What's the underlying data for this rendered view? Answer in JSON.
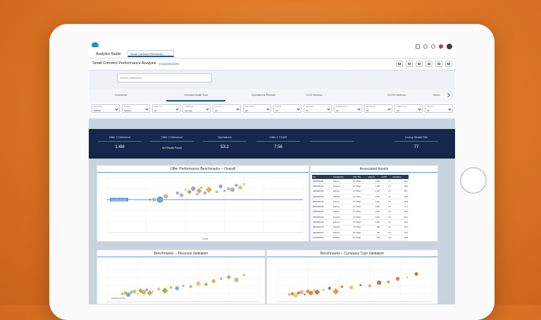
{
  "app": {
    "name": "Analytics Studio",
    "tab_label": "Small Connect Performan..."
  },
  "dashboard": {
    "title": "Small Connect Performance Analysis",
    "subtitle": "▾ DASHBOARD"
  },
  "search": {
    "placeholder": "Search dashboards"
  },
  "tabs": [
    {
      "label": "Overview"
    },
    {
      "label": "Connect Audit Tool"
    },
    {
      "label": "Operations Review"
    },
    {
      "label": "CCD Review"
    },
    {
      "label": "CCRD Metrics"
    },
    {
      "label": "More"
    }
  ],
  "filters": [
    {
      "label": "Cl Number",
      "value": "PHASE"
    },
    {
      "label": "Product",
      "value": "Subject"
    },
    {
      "label": "Segment",
      "value": "All"
    },
    {
      "label": "Cl Manager",
      "value": "Average"
    },
    {
      "label": "Location",
      "value": "All"
    },
    {
      "label": "Site Number",
      "value": "All"
    },
    {
      "label": "Unit ID",
      "value": "All"
    },
    {
      "label": "Call Label",
      "value": "All"
    },
    {
      "label": "Al Wage Form",
      "value": "All"
    },
    {
      "label": "Level Code",
      "value": "All"
    },
    {
      "label": "CCRD Code",
      "value": "All"
    },
    {
      "label": "Country",
      "value": "All"
    }
  ],
  "kpis": [
    {
      "label": "Offer 1 Delivered",
      "value": "1.4M"
    },
    {
      "label": "Offer 2 Delivered",
      "value": "No Results Found"
    },
    {
      "label": "Operations",
      "value": "53.2"
    },
    {
      "label": "Offer 1 CCDR",
      "value": "7.56"
    },
    {
      "label": "",
      "value": ""
    },
    {
      "label": "Lineup Model Site",
      "value": "77"
    }
  ],
  "overall_chart": {
    "title": "Offer Performance Benchmarks -- Overall",
    "xlabel": "Close",
    "reference_label": "Avg Benchmark",
    "reference_y": 60
  },
  "assoc": {
    "title": "Associated Assets",
    "columns": [
      "Ref",
      "Classification",
      "Offer Title",
      "Delivery",
      "CCRR",
      "Operations"
    ],
    "rows": [
      [
        "ID000081261",
        "Delivery",
        "CT Offset",
        "1.23K",
        "2.7",
        "60.2"
      ],
      [
        "ID000081262",
        "Advance",
        "CT Offset",
        "1.16K",
        "2.4",
        "58.5"
      ],
      [
        "ID000081263",
        "Delivery",
        "CT Offset",
        "1.13K",
        "2.1",
        "55.7"
      ],
      [
        "ID000081264",
        "Advance",
        "CT Offset",
        "1.11K",
        "1.4",
        "54.8"
      ],
      [
        "ID000081265",
        "Delivery",
        "CT Offset",
        "1.02K",
        "2.4",
        "53.9"
      ],
      [
        "ID000081266",
        "Delivery",
        "CT Offset",
        "1.02K",
        "2.3",
        "57.1"
      ],
      [
        "ID000081267",
        "Delivery",
        "CT Offset",
        "1.01K",
        "3.1",
        "52.6"
      ],
      [
        "ID000081268",
        "Advance",
        "CT Offset",
        "1.01K",
        "1.8",
        "52.1"
      ],
      [
        "ID000081269",
        "Delivery",
        "CT Offset",
        "1.00K",
        "2.1",
        "51.9"
      ],
      [
        "ID000081270",
        "Advance",
        "CT Offset",
        "967",
        "2.4",
        "51.5"
      ],
      [
        "ID000081271",
        "Delivery",
        "CT Offset",
        "931",
        "2.6",
        "51.2"
      ],
      [
        "ID000081272",
        "Advance",
        "CT Offset",
        "926",
        "1.9",
        "50.8"
      ],
      [
        "ID000081273",
        "Delivery",
        "CT Offset",
        "909",
        "2.4",
        "50.5"
      ],
      [
        "ID000081274",
        "Advance",
        "CT Offset",
        "874",
        "2.3",
        "50.1"
      ],
      [
        "ID000081275",
        "Delivery",
        "CT Offset",
        "853",
        "2.2",
        "49.9"
      ]
    ]
  },
  "personal_chart": {
    "title": "Benchmarks -- Personal Validation",
    "annotation": "Avg Benchmark"
  },
  "company_chart": {
    "title": "Benchmarks -- Company Type Validation"
  },
  "chart_data": [
    {
      "type": "scatter",
      "title": "Offer Performance Benchmarks -- Overall",
      "xlabel": "Close",
      "ylabel": "",
      "xlim": [
        0,
        100
      ],
      "ylim": [
        0,
        100
      ],
      "grid": true,
      "x": [
        22,
        24,
        30,
        36,
        38,
        40,
        42,
        44,
        46,
        47,
        48,
        50,
        52,
        56,
        58,
        60,
        62,
        64,
        66,
        68,
        70
      ],
      "y": [
        60,
        60,
        66,
        72,
        68,
        78,
        74,
        80,
        70,
        76,
        82,
        72,
        78,
        74,
        84,
        76,
        80,
        78,
        86,
        82,
        88
      ]
    },
    {
      "type": "scatter",
      "title": "Benchmarks -- Personal Validation",
      "xlim": [
        0,
        100
      ],
      "ylim": [
        0,
        100
      ],
      "grid": true,
      "x": [
        10,
        12,
        14,
        16,
        18,
        20,
        22,
        24,
        26,
        28,
        30,
        34,
        38,
        42,
        46,
        50,
        55,
        60,
        65,
        70,
        75,
        80,
        85,
        90
      ],
      "y": [
        20,
        22,
        18,
        24,
        26,
        20,
        28,
        24,
        30,
        22,
        26,
        32,
        28,
        36,
        34,
        40,
        38,
        46,
        44,
        52,
        58,
        62,
        55,
        68
      ]
    },
    {
      "type": "scatter",
      "title": "Benchmarks -- Company Type Validation",
      "xlim": [
        0,
        100
      ],
      "ylim": [
        0,
        100
      ],
      "grid": true,
      "x": [
        8,
        10,
        12,
        14,
        16,
        18,
        20,
        22,
        24,
        26,
        30,
        34,
        38,
        42,
        48,
        54,
        60,
        66,
        72,
        78,
        84,
        90
      ],
      "y": [
        18,
        20,
        16,
        22,
        24,
        18,
        26,
        22,
        28,
        24,
        30,
        34,
        26,
        38,
        36,
        42,
        40,
        48,
        50,
        58,
        62,
        70
      ]
    }
  ],
  "colors": {
    "accent": "#1b5297",
    "kpi_bg": "#15284b",
    "scatter_blue": "#5b9bd5",
    "orange": "#f0a030",
    "green": "#8cbf4a"
  }
}
